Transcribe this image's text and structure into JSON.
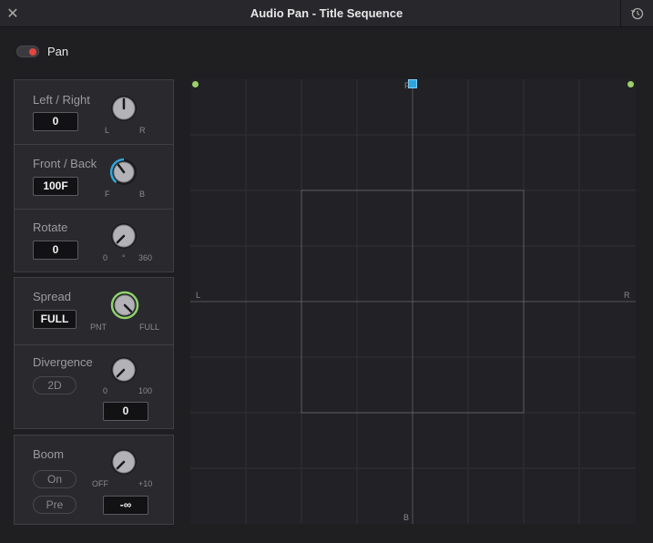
{
  "window": {
    "title": "Audio Pan - Title Sequence",
    "close_icon": "close-icon",
    "reset_icon": "reset-history-icon"
  },
  "pan": {
    "label": "Pan",
    "enabled": true
  },
  "left_right": {
    "label": "Left / Right",
    "value": "0",
    "min_label": "L",
    "max_label": "R"
  },
  "front_back": {
    "label": "Front / Back",
    "value": "100F",
    "min_label": "F",
    "max_label": "B"
  },
  "rotate": {
    "label": "Rotate",
    "value": "0",
    "min_label": "0",
    "unit_label": "°",
    "max_label": "360"
  },
  "spread": {
    "label": "Spread",
    "value": "FULL",
    "min_label": "PNT",
    "max_label": "FULL"
  },
  "divergence": {
    "label": "Divergence",
    "mode": "2D",
    "value": "0",
    "min_label": "0",
    "max_label": "100"
  },
  "boom": {
    "label": "Boom",
    "on_label": "On",
    "pre_label": "Pre",
    "value": "-∞",
    "min_label": "OFF",
    "max_label": "+10"
  },
  "grid": {
    "front_label": "F",
    "back_label": "B",
    "left_label": "L",
    "right_label": "R"
  },
  "colors": {
    "toggle_on": "#e0463c",
    "accent_blue": "#2ea6dd",
    "spread_ring": "#8fd26b",
    "corner_dot": "#9ed06a"
  }
}
